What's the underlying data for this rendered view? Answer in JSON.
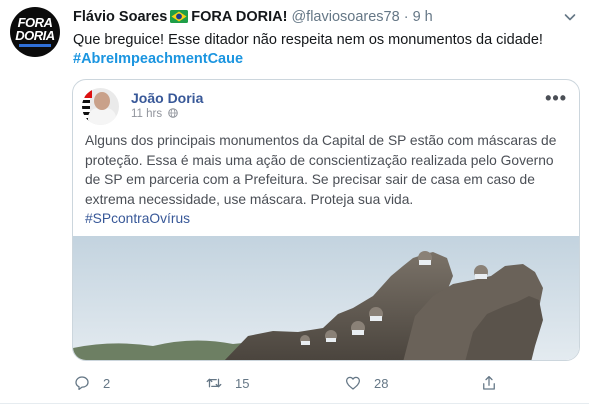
{
  "tweet": {
    "avatar_text": {
      "line1": "FORA",
      "line2": "DORIA"
    },
    "author_name": "Flávio Soares",
    "flag_icon": "brazil-flag-icon",
    "author_suffix": "FORA DORIA!",
    "handle": "@flaviosoares78",
    "separator": "·",
    "time": "9 h",
    "text": "Que breguice! Esse ditador não respeita nem os monumentos da cidade!",
    "hashtag": "#AbreImpeachmentCaue",
    "actions": {
      "reply_count": "2",
      "retweet_count": "15",
      "like_count": "28"
    }
  },
  "embedded_post": {
    "author": "João Doria",
    "time": "11 hrs",
    "body": "Alguns dos principais monumentos da Capital de SP estão com máscaras de proteção. Essa é mais uma ação de conscientização realizada pelo Governo de SP em parceria com a Prefeitura. Se precisar sair de casa em caso de extrema necessidade, use máscara. Proteja sua vida.",
    "hashtag": "#SPcontraOvírus",
    "more_icon": "more-dots-icon"
  },
  "colors": {
    "link": "#1b95e0",
    "fb_link": "#385898",
    "muted": "#657786",
    "sky": "#cfdbe5"
  }
}
